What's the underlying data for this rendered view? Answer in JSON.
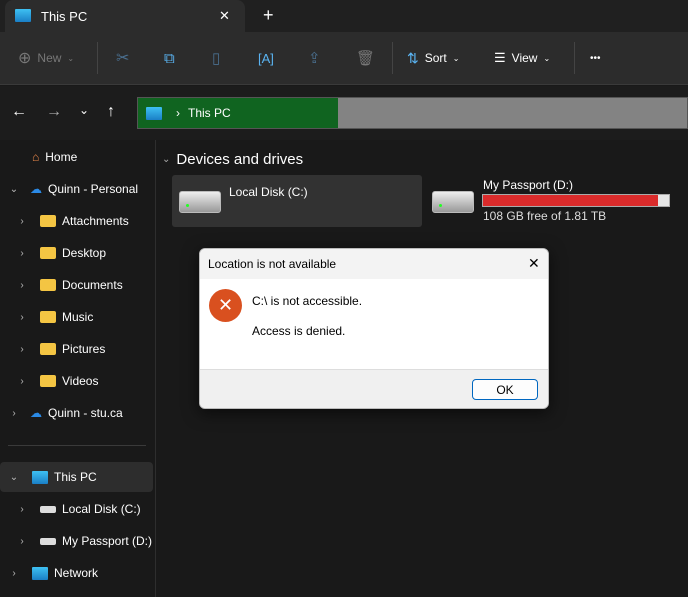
{
  "tab": {
    "title": "This PC",
    "close": "✕",
    "new": "+"
  },
  "toolbar": {
    "new": "New",
    "sort": "Sort",
    "view": "View",
    "more": "•••"
  },
  "address": {
    "location": "This PC",
    "sep": "›"
  },
  "sidebar": {
    "items": [
      {
        "label": "Home"
      },
      {
        "label": "Quinn - Personal"
      },
      {
        "label": "Attachments"
      },
      {
        "label": "Desktop"
      },
      {
        "label": "Documents"
      },
      {
        "label": "Music"
      },
      {
        "label": "Pictures"
      },
      {
        "label": "Videos"
      },
      {
        "label": "Quinn - stu.ca"
      },
      {
        "label": "This PC"
      },
      {
        "label": "Local Disk (C:)"
      },
      {
        "label": "My Passport (D:)"
      },
      {
        "label": "Network"
      }
    ]
  },
  "main": {
    "section": "Devices and drives",
    "drives": [
      {
        "name": "Local Disk (C:)"
      },
      {
        "name": "My Passport (D:)",
        "free": "108 GB free of 1.81 TB",
        "used_fraction": 0.94,
        "bar_color": "#da2b2b"
      }
    ]
  },
  "dialog": {
    "title": "Location is not available",
    "message": "C:\\ is not accessible.",
    "detail": "Access is denied.",
    "ok": "OK",
    "close": "✕"
  }
}
